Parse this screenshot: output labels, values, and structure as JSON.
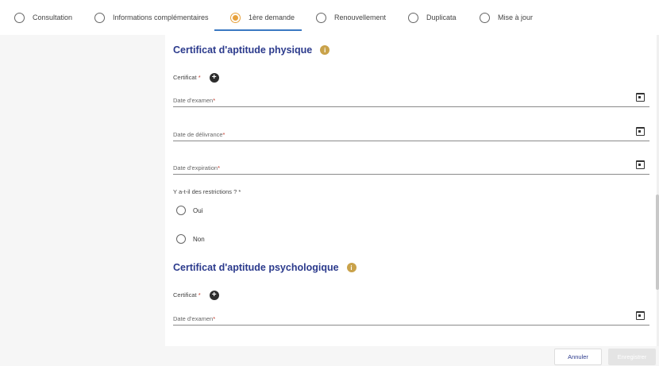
{
  "tabs": [
    {
      "label": "Consultation",
      "selected": false
    },
    {
      "label": "Informations complémentaires",
      "selected": false
    },
    {
      "label": "1ère demande",
      "selected": true
    },
    {
      "label": "Renouvellement",
      "selected": false
    },
    {
      "label": "Duplicata",
      "selected": false
    },
    {
      "label": "Mise à jour",
      "selected": false
    }
  ],
  "colors": {
    "accent": "#e7a13c",
    "title": "#2b3a8c",
    "tab_underline": "#3a78c2",
    "info": "#c9a24a"
  },
  "section1": {
    "title": "Certificat d'aptitude physique",
    "info_icon": "info-icon",
    "certificat_label": "Certificat",
    "required_mark": "*",
    "date_examen": "Date d'examen",
    "date_delivrance": "Date de délivrance",
    "date_expiration": "Date d'expiration",
    "restrictions_question": "Y a-t-il des restrictions ? *",
    "option_oui": "Oui",
    "option_non": "Non"
  },
  "section2": {
    "title": "Certificat d'aptitude psychologique",
    "info_icon": "info-icon",
    "certificat_label": "Certificat",
    "required_mark": "*",
    "date_examen": "Date d'examen"
  },
  "plus_icon": "+",
  "info_glyph": "i",
  "buttons": {
    "cancel": "Annuler",
    "save": "Enregistrer"
  }
}
